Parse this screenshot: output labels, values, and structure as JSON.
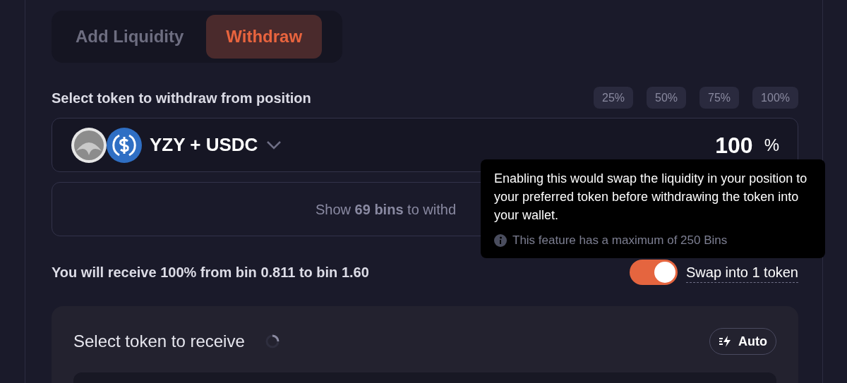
{
  "tabs": [
    {
      "label": "Add Liquidity",
      "selected": false
    },
    {
      "label": "Withdraw",
      "selected": true
    }
  ],
  "withdraw_label": "Select token to withdraw from position",
  "percent_chips": [
    {
      "label": "25%"
    },
    {
      "label": "50%"
    },
    {
      "label": "75%"
    },
    {
      "label": "100%"
    }
  ],
  "token_pair": {
    "label": "YZY + USDC",
    "amount": "100",
    "unit": "%"
  },
  "bins_button": "Show **69 bins** to withd",
  "receive_text": "You will receive 100% from bin 0.811 to bin 1.60",
  "swap_toggle": {
    "label": "Swap into 1 token",
    "on": true
  },
  "tooltip": {
    "text": "Enabling this would swap the liquidity in your position to your preferred token before withdrawing the token into your wallet.",
    "note": "This feature has a maximum of 250 Bins"
  },
  "receive_card": {
    "title": "Select token to receive",
    "loading": true,
    "auto_button": "Auto"
  }
}
